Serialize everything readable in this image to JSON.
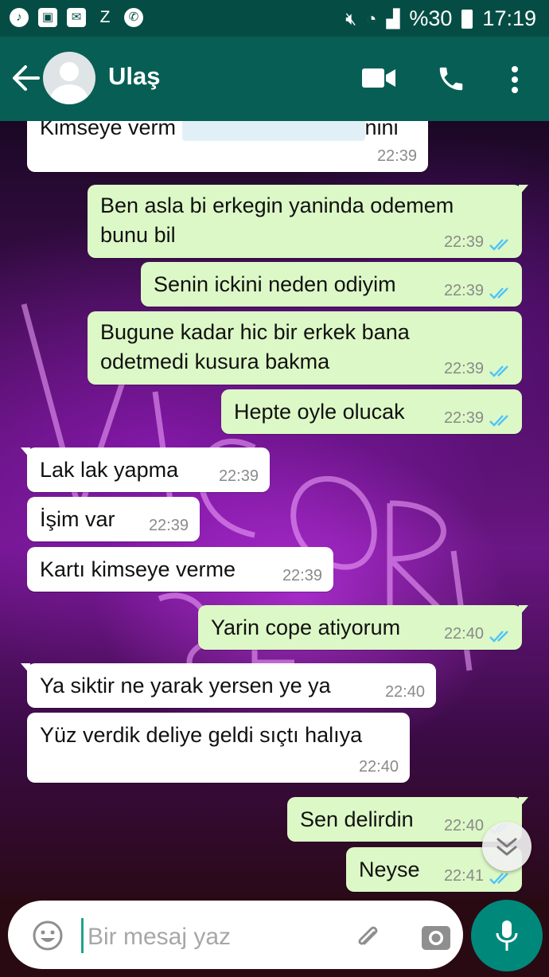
{
  "status_bar": {
    "left_icons": [
      "music-icon",
      "image-icon",
      "mail-icon",
      "z",
      "phone-icon"
    ],
    "z_label": "Z",
    "battery": "%30",
    "time": "17:19"
  },
  "header": {
    "contact_name": "Ulaş"
  },
  "messages": [
    {
      "dir": "in",
      "text": "Kimseye verm",
      "time": "22:39",
      "partial": true,
      "suffix": "nini"
    },
    {
      "dir": "out",
      "text": "Ben asla bi erkegin yaninda odemem\nbunu bil",
      "time": "22:39"
    },
    {
      "dir": "out",
      "text": "Senin ickini neden odiyim",
      "time": "22:39"
    },
    {
      "dir": "out",
      "text": "Bugune kadar hic bir erkek bana\nodetmedi kusura bakma",
      "time": "22:39"
    },
    {
      "dir": "out",
      "text": "Hepte oyle olucak",
      "time": "22:39"
    },
    {
      "dir": "in",
      "text": "Lak lak yapma",
      "time": "22:39"
    },
    {
      "dir": "in",
      "text": "İşim var",
      "time": "22:39"
    },
    {
      "dir": "in",
      "text": "Kartı kimseye verme",
      "time": "22:39"
    },
    {
      "dir": "out",
      "text": "Yarin cope atiyorum",
      "time": "22:40"
    },
    {
      "dir": "in",
      "text": "Ya siktir ne yarak yersen ye ya",
      "time": "22:40"
    },
    {
      "dir": "in",
      "text": "Yüz verdik deliye geldi sıçtı halıya",
      "time": "22:40"
    },
    {
      "dir": "out",
      "text": "Sen delirdin",
      "time": "22:40"
    },
    {
      "dir": "out",
      "text": "Neyse",
      "time": "22:41"
    }
  ],
  "input": {
    "placeholder": "Bir mesaj yaz"
  },
  "colors": {
    "header": "#075e54",
    "status_bar": "#054d44",
    "outgoing_bubble": "#dcf8c6",
    "incoming_bubble": "#ffffff",
    "read_ticks": "#4fc3f7",
    "mic_button": "#00897b"
  }
}
